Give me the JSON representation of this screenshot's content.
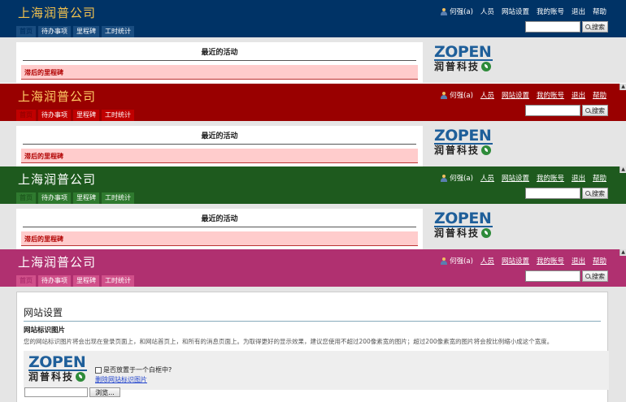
{
  "company": "上海润普公司",
  "user": "何强(a)",
  "nav": {
    "people": "人员",
    "site_settings": "网站设置",
    "my_account": "我的账号",
    "logout": "退出",
    "help": "帮助"
  },
  "search": {
    "button": "搜索",
    "value": ""
  },
  "tabs": [
    "首页",
    "待办事项",
    "里程碑",
    "工时统计"
  ],
  "activity_title": "最近的活动",
  "late_milestones": "滞后的里程碑",
  "logo": {
    "word": "ZOPEN",
    "cn": "润普科技"
  },
  "themes": {
    "blue": "#003366",
    "red": "#990000",
    "green": "#1e5a1e",
    "pink": "#b03070"
  },
  "settings": {
    "title": "网站设置",
    "section": "网站标识图片",
    "description": "您的网站标识图片将会出现在登录页面上，和网站首页上，和所有的消息页面上。为取得更好的显示效果，建议您使用不超过200像素宽的图片；超过200像素宽的图片将会按比例缩小成这个宽度。",
    "checkbox_label": "是否放置于一个白框中?",
    "delete_link": "删除网站标识图片",
    "browse_button": "浏览..."
  }
}
